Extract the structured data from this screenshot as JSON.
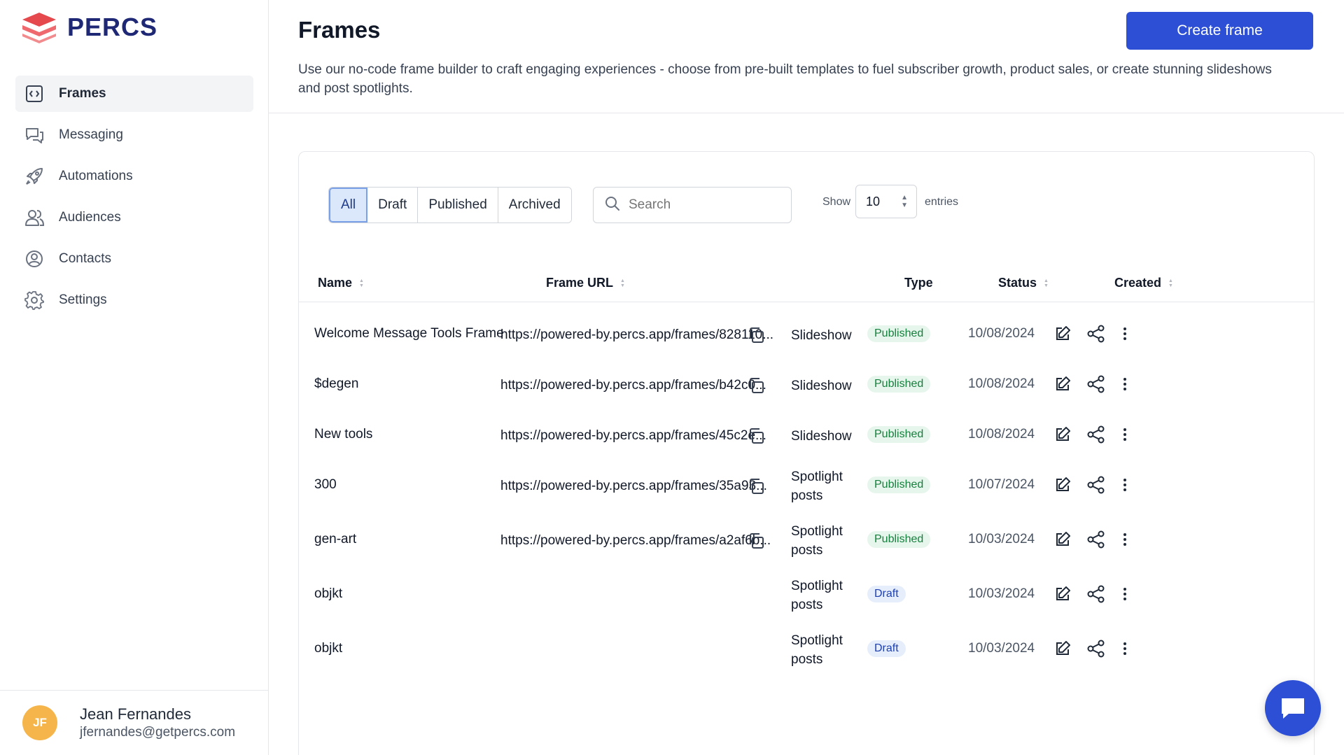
{
  "brand": {
    "name": "PERCS",
    "logo_color": "#e5484d"
  },
  "sidebar": {
    "items": [
      {
        "label": "Frames",
        "icon": "frame-code-icon",
        "active": true
      },
      {
        "label": "Messaging",
        "icon": "chat-bubbles-icon",
        "active": false
      },
      {
        "label": "Automations",
        "icon": "rocket-icon",
        "active": false
      },
      {
        "label": "Audiences",
        "icon": "users-icon",
        "active": false
      },
      {
        "label": "Contacts",
        "icon": "user-circle-icon",
        "active": false
      },
      {
        "label": "Settings",
        "icon": "gear-icon",
        "active": false
      }
    ]
  },
  "user": {
    "initials": "JF",
    "name": "Jean Fernandes",
    "email": "jfernandes@getpercs.com"
  },
  "header": {
    "title": "Frames",
    "description": "Use our no-code frame builder to craft engaging experiences - choose from pre-built templates to fuel subscriber growth, product sales, or create stunning slideshows and post spotlights.",
    "create_button": "Create frame"
  },
  "filters": {
    "tabs": [
      "All",
      "Draft",
      "Published",
      "Archived"
    ],
    "active": "All"
  },
  "search": {
    "placeholder": "Search",
    "value": ""
  },
  "pagination": {
    "show_label": "Show",
    "entries_value": "10",
    "entries_label": "entries"
  },
  "table": {
    "columns": [
      "Name",
      "Frame URL",
      "Type",
      "Status",
      "Created"
    ],
    "rows": [
      {
        "name": "Welcome Message Tools Frame",
        "url": "https://powered-by.percs.app/frames/828110...",
        "type": "Slideshow",
        "status": "Published",
        "created": "10/08/2024"
      },
      {
        "name": "$degen",
        "url": "https://powered-by.percs.app/frames/b42c0...",
        "type": "Slideshow",
        "status": "Published",
        "created": "10/08/2024"
      },
      {
        "name": "New tools",
        "url": "https://powered-by.percs.app/frames/45c2e...",
        "type": "Slideshow",
        "status": "Published",
        "created": "10/08/2024"
      },
      {
        "name": "300",
        "url": "https://powered-by.percs.app/frames/35a93...",
        "type": "Spotlight posts",
        "status": "Published",
        "created": "10/07/2024"
      },
      {
        "name": "gen-art",
        "url": "https://powered-by.percs.app/frames/a2af6b...",
        "type": "Spotlight posts",
        "status": "Published",
        "created": "10/03/2024"
      },
      {
        "name": "objkt",
        "url": "",
        "type": "Spotlight posts",
        "status": "Draft",
        "created": "10/03/2024"
      },
      {
        "name": "objkt",
        "url": "",
        "type": "Spotlight posts",
        "status": "Draft",
        "created": "10/03/2024"
      }
    ]
  },
  "colors": {
    "primary": "#2c4fd6",
    "published_bg": "#e7f6ec",
    "published_text": "#15803d",
    "draft_bg": "#e6eefb",
    "draft_text": "#1e40af"
  }
}
